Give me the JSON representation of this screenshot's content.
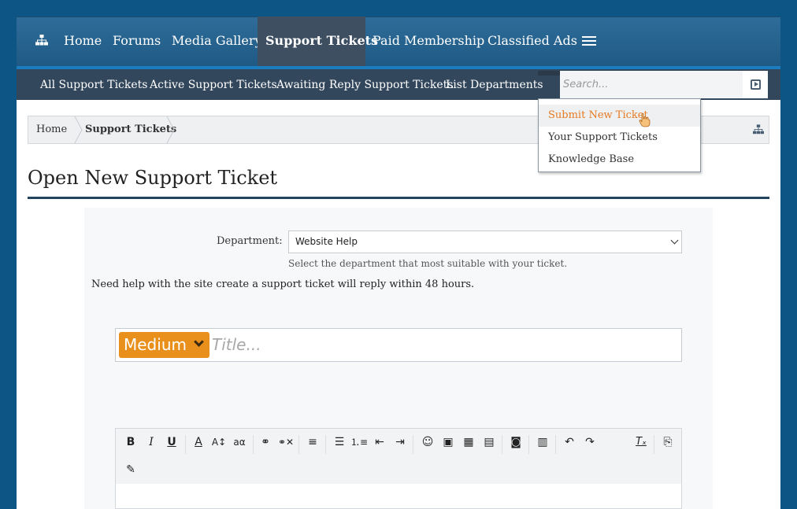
{
  "topnav": {
    "items": [
      {
        "label": "Home"
      },
      {
        "label": "Forums"
      },
      {
        "label": "Media Gallery"
      },
      {
        "label": "Support Tickets"
      },
      {
        "label": "Paid Membership"
      },
      {
        "label": "Classified Ads"
      }
    ],
    "active": "Support Tickets"
  },
  "subnav": {
    "items": [
      {
        "label": "All Support Tickets"
      },
      {
        "label": "Active Support Tickets"
      },
      {
        "label": "Awaiting Reply Support Tickets"
      },
      {
        "label": "List Departments"
      }
    ],
    "search_placeholder": "Search..."
  },
  "dropdown": {
    "items": [
      {
        "label": "Submit New Ticket"
      },
      {
        "label": "Your Support Tickets"
      },
      {
        "label": "Knowledge Base"
      }
    ],
    "highlighted": "Submit New Ticket"
  },
  "breadcrumb": {
    "items": [
      {
        "label": "Home"
      },
      {
        "label": "Support Tickets"
      }
    ]
  },
  "page": {
    "title": "Open New Support Ticket"
  },
  "form": {
    "department_label": "Department:",
    "department_value": "Website Help",
    "department_hint": "Select the department that most suitable with your ticket.",
    "help_text": "Need help with the site create a support ticket will reply within 48 hours.",
    "priority_value": "Medium",
    "title_placeholder": "Title..."
  },
  "editor": {
    "toolbar": [
      "bold-icon",
      "italic-icon",
      "underline-icon",
      "text-color-icon",
      "font-size-icon",
      "font-family-icon",
      "link-icon",
      "unlink-icon",
      "align-icon",
      "bullet-list-icon",
      "numbered-list-icon",
      "outdent-icon",
      "indent-icon",
      "smilie-icon",
      "image-icon",
      "media-icon",
      "quote-icon",
      "camera-icon",
      "save-draft-icon",
      "undo-icon",
      "redo-icon",
      "remove-format-icon",
      "preview-icon",
      "bbcode-icon"
    ]
  },
  "colors": {
    "accent": "#e8901b",
    "nav_dark": "#33475c",
    "highlight_text": "#e57a22",
    "page_background": "#0c5584"
  }
}
